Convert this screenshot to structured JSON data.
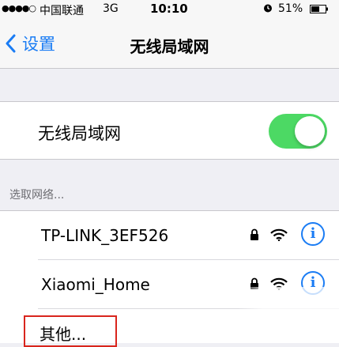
{
  "status_bar": {
    "signal": "●●●●○",
    "carrier": "中国联通",
    "network": "3G",
    "time": "10:10",
    "alarm_icon": "alarm-icon",
    "battery_percent": "51%"
  },
  "nav": {
    "back_label": "设置",
    "title": "无线局域网"
  },
  "wifi": {
    "label": "无线局域网",
    "enabled": true,
    "switch_color": "#4cd964"
  },
  "section_header": "选取网络...",
  "networks": [
    {
      "name": "TP-LINK_3EF526",
      "locked": true
    },
    {
      "name": "Xiaomi_Home",
      "locked": true
    }
  ],
  "other": {
    "label": "其他..."
  },
  "colors": {
    "accent": "#1a7cf4",
    "highlight": "#d9251d"
  }
}
